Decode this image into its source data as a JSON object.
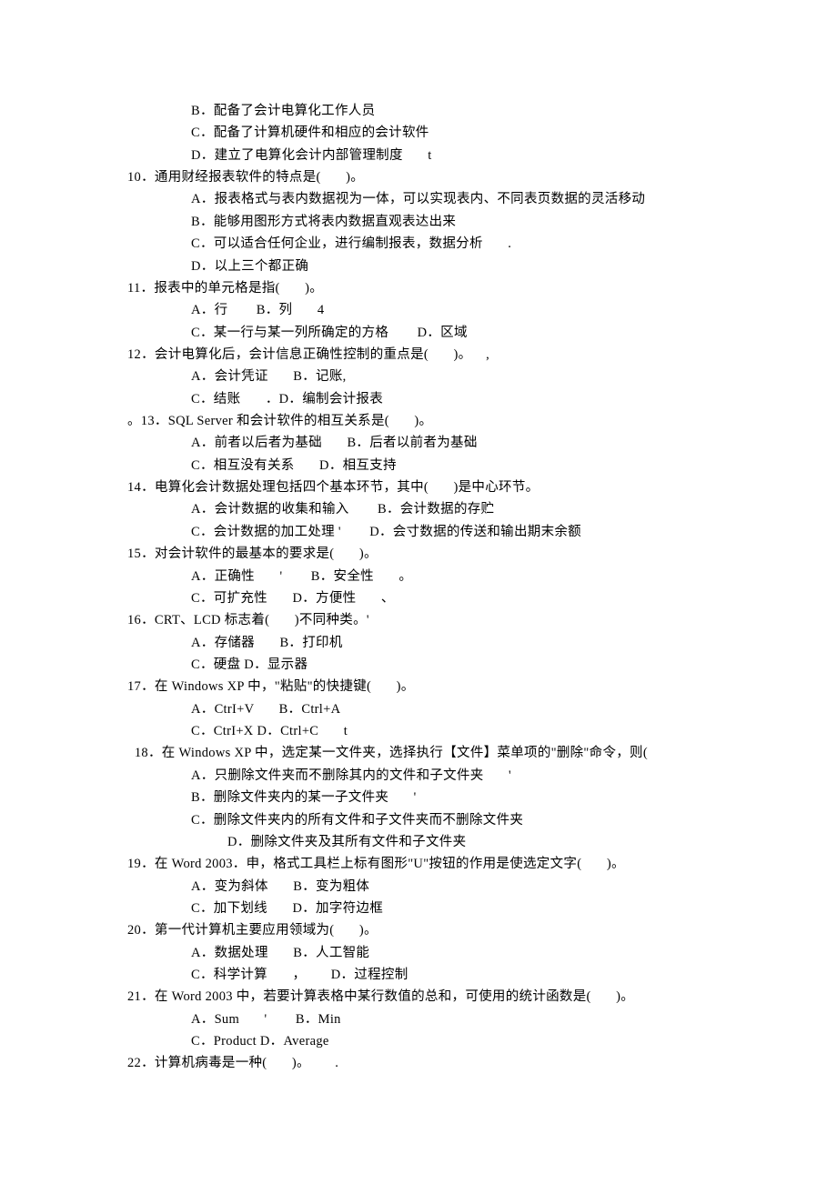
{
  "lines": [
    {
      "cls": "opt1",
      "t": "B．配备了会计电算化工作人员"
    },
    {
      "cls": "opt1",
      "t": "C．配备了计算机硬件和相应的会计软件"
    },
    {
      "cls": "opt1",
      "t": "D．建立了电算化会计内部管理制度       t"
    },
    {
      "cls": "q",
      "t": "10．通用财经报表软件的特点是(       )。"
    },
    {
      "cls": "opt1",
      "t": "A．报表格式与表内数据视为一体，可以实现表内、不同表页数据的灵活移动"
    },
    {
      "cls": "opt1",
      "t": "B．能够用图形方式将表内数据直观表达出来"
    },
    {
      "cls": "opt1",
      "t": "C．可以适合任何企业，进行编制报表，数据分析       ."
    },
    {
      "cls": "opt1",
      "t": "D．以上三个都正确"
    },
    {
      "cls": "q",
      "t": "11．报表中的单元格是指(       )。"
    },
    {
      "cls": "opt1",
      "t": "A．行        B．列       4"
    },
    {
      "cls": "opt1",
      "t": "C．某一行与某一列所确定的方格        D．区域"
    },
    {
      "cls": "q",
      "t": "12．会计电算化后，会计信息正确性控制的重点是(       )。    ,"
    },
    {
      "cls": "opt1",
      "t": "A．会计凭证       B．记账,"
    },
    {
      "cls": "opt1",
      "t": "C．结账       ．D．编制会计报表"
    },
    {
      "cls": "q",
      "t": "。13．SQL Server 和会计软件的相互关系是(       )。"
    },
    {
      "cls": "opt1",
      "t": "A．前者以后者为基础       B．后者以前者为基础"
    },
    {
      "cls": "opt1",
      "t": "C．相互没有关系       D．相互支持"
    },
    {
      "cls": "q",
      "t": "14．电算化会计数据处理包括四个基本环节，其中(       )是中心环节。"
    },
    {
      "cls": "opt1",
      "t": "A．会计数据的收集和输入        B．会计数据的存贮"
    },
    {
      "cls": "opt1",
      "t": "C．会计数据的加工处理 '        D．会寸数据的传送和输出期末余额"
    },
    {
      "cls": "q",
      "t": "15．对会计软件的最基本的要求是(       )。"
    },
    {
      "cls": "opt1",
      "t": "A．正确性       '        B．安全性       。"
    },
    {
      "cls": "opt1",
      "t": "C．可扩充性       D．方便性       、"
    },
    {
      "cls": "q",
      "t": "16．CRT、LCD 标志着(       )不同种类。'"
    },
    {
      "cls": "opt1",
      "t": "A．存储器       B．打印机"
    },
    {
      "cls": "opt1",
      "t": "C．硬盘 D．显示器"
    },
    {
      "cls": "q",
      "t": "17．在 Windows XP 中，\"粘贴\"的快捷键(       )。"
    },
    {
      "cls": "opt1",
      "t": "A．CtrI+V       B．Ctrl+A"
    },
    {
      "cls": "opt1",
      "t": "C．CtrI+X D．Ctrl+C       t"
    },
    {
      "cls": "q",
      "t": "  18．在 Windows XP 中，选定某一文件夹，选择执行【文件】菜单项的\"删除\"命令，则("
    },
    {
      "cls": "opt1",
      "t": "A．只删除文件夹而不删除其内的文件和子文件夹       '"
    },
    {
      "cls": "opt1",
      "t": "B．删除文件夹内的某一子文件夹       '"
    },
    {
      "cls": "opt1",
      "t": "C．删除文件夹内的所有文件和子文件夹而不删除文件夹"
    },
    {
      "cls": "opt2",
      "t": "D．删除文件夹及其所有文件和子文件夹"
    },
    {
      "cls": "q",
      "t": "19．在 Word 2003．申，格式工具栏上标有图形\"U\"按钮的作用是使选定文字(       )。"
    },
    {
      "cls": "opt1",
      "t": "A．变为斜体       B．变为粗体"
    },
    {
      "cls": "opt1",
      "t": "C．加下划线       D．加字符边框"
    },
    {
      "cls": "q",
      "t": "20．第一代计算机主要应用领域为(       )。"
    },
    {
      "cls": "opt1",
      "t": "A．数据处理       B．人工智能"
    },
    {
      "cls": "opt1",
      "t": "C．科学计算       ，       D．过程控制"
    },
    {
      "cls": "q",
      "t": "21．在 Word 2003 中，若要计算表格中某行数值的总和，可使用的统计函数是(       )。"
    },
    {
      "cls": "opt1",
      "t": "A．Sum       '        B．Min"
    },
    {
      "cls": "opt1",
      "t": "C．Product D．Average"
    },
    {
      "cls": "q",
      "t": "22．计算机病毒是一种(       )。       ."
    }
  ]
}
